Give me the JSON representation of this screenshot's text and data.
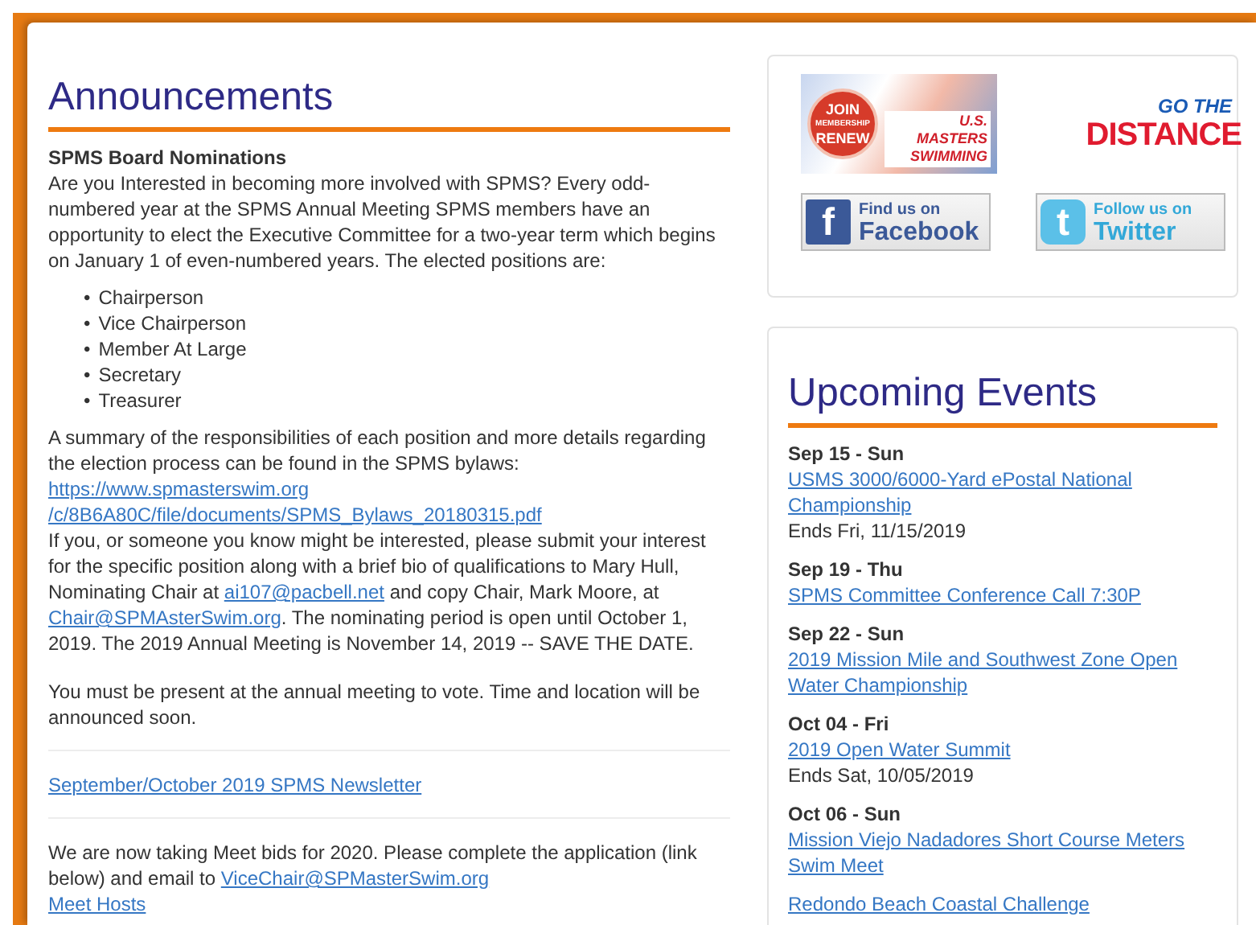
{
  "announcements": {
    "title": "Announcements",
    "blocks": [
      {
        "kind": "heading",
        "text": "SPMS Board Nominations"
      },
      {
        "kind": "paragraph",
        "parts": [
          {
            "kind": "text",
            "text": "Are you Interested in becoming more involved with SPMS? Every odd-numbered year at the SPMS Annual Meeting SPMS members have an opportunity to elect the Executive Committee for a two-year term which begins on January 1 of even-numbered years. The elected positions are:"
          }
        ]
      },
      {
        "kind": "list",
        "marker": "•",
        "items": [
          "Chairperson",
          "Vice Chairperson",
          "Member At Large",
          "Secretary",
          "Treasurer"
        ]
      },
      {
        "kind": "paragraph",
        "parts": [
          {
            "kind": "text",
            "text": "A summary of the responsibilities of each position and more details regarding the election process can be found in the SPMS bylaws: "
          },
          {
            "kind": "link",
            "text": "https://www.spmasterswim.org"
          },
          {
            "kind": "link",
            "text": "/c/8B6A80C/file/documents/SPMS_Bylaws_20180315.pdf"
          },
          {
            "kind": "break"
          },
          {
            "kind": "text",
            "text": "If you, or someone you know might be interested, please submit your interest for the specific position along with a brief bio of qualifications to Mary Hull, Nominating Chair at "
          },
          {
            "kind": "link",
            "text": "ai107@pacbell.net"
          },
          {
            "kind": "text",
            "text": " and copy Chair, Mark Moore, at "
          },
          {
            "kind": "link",
            "text": "Chair@SPMAsterSwim.org"
          },
          {
            "kind": "text",
            "text": ". The nominating period is open until October 1, 2019. The 2019 Annual Meeting is November 14, 2019 -- SAVE THE DATE."
          }
        ]
      },
      {
        "kind": "paragraph",
        "parts": [
          {
            "kind": "text",
            "text": "You must be present at the annual meeting to vote. Time and location will be announced soon."
          }
        ]
      },
      {
        "kind": "divider"
      },
      {
        "kind": "paragraph",
        "parts": [
          {
            "kind": "link",
            "text": "September/October 2019 SPMS Newsletter"
          }
        ]
      },
      {
        "kind": "divider"
      },
      {
        "kind": "paragraph",
        "parts": [
          {
            "kind": "text",
            "text": "We are now taking Meet bids for 2020.  Please complete the application (link below) and email to "
          },
          {
            "kind": "link",
            "text": "ViceChair@SPMasterSwim.org"
          },
          {
            "kind": "break"
          },
          {
            "kind": "link",
            "text": "Meet Hosts"
          }
        ]
      }
    ]
  },
  "banners": [
    {
      "kind": "membership",
      "badge": [
        "JOIN",
        "MEMBERSHIP",
        "RENEW"
      ],
      "caption": [
        "U.S. MASTERS",
        "SWIMMING"
      ]
    },
    {
      "kind": "distance",
      "caption": [
        "GO THE",
        "DISTANCE"
      ]
    },
    {
      "kind": "facebook",
      "glyph": "f",
      "caption": [
        "Find us on",
        "Facebook"
      ]
    },
    {
      "kind": "twitter",
      "glyph": "t",
      "caption": [
        "Follow us on",
        "Twitter"
      ]
    }
  ],
  "events": {
    "title": "Upcoming Events",
    "items": [
      {
        "date": "Sep 15 - Sun",
        "title": "USMS 3000/6000-Yard ePostal National Championship",
        "note": "Ends Fri, 11/15/2019"
      },
      {
        "date": "Sep 19 - Thu",
        "title": "SPMS Committee Conference Call 7:30P"
      },
      {
        "date": "Sep 22 - Sun",
        "title": "2019 Mission Mile and Southwest Zone Open Water Championship"
      },
      {
        "date": "Oct 04 - Fri",
        "title": "2019 Open Water Summit",
        "note": "Ends Sat, 10/05/2019"
      },
      {
        "date": "Oct 06 - Sun",
        "title": "Mission Viejo Nadadores Short Course Meters Swim Meet"
      },
      {
        "title": "Redondo Beach Coastal Challenge"
      }
    ]
  }
}
